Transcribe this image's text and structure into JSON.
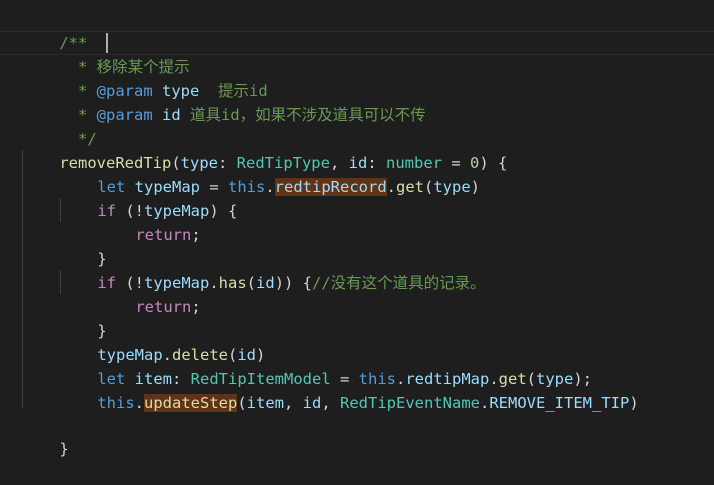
{
  "lines": {
    "l1": "/**",
    "l2": "  * 移除某个提示",
    "l3_prefix": "  * ",
    "l3_tag": "@param",
    "l3_space": " ",
    "l3_name": "type",
    "l3_desc": "  提示id",
    "l4_prefix": "  * ",
    "l4_tag": "@param",
    "l4_space": " ",
    "l4_name": "id",
    "l4_desc": " 道具id，如果不涉及道具可以不传",
    "l5": "  */",
    "l6_fn": "removeRedTip",
    "l6_p1": "(",
    "l6_type_param": "type",
    "l6_colon1": ": ",
    "l6_type1": "RedTipType",
    "l6_comma": ", ",
    "l6_id_param": "id",
    "l6_colon2": ": ",
    "l6_type2": "number",
    "l6_eq": " = ",
    "l6_num": "0",
    "l6_end": ") {",
    "l7_let": "let",
    "l7_sp": " ",
    "l7_var": "typeMap",
    "l7_eq": " = ",
    "l7_this": "this",
    "l7_dot": ".",
    "l7_prop": "redtipRecord",
    "l7_dot2": ".",
    "l7_get": "get",
    "l7_open": "(",
    "l7_arg": "type",
    "l7_close": ")",
    "l8_if": "if",
    "l8_open": " (!",
    "l8_var": "typeMap",
    "l8_end": ") {",
    "l9_return": "return",
    "l9_semi": ";",
    "l10": "}",
    "l11_if": "if",
    "l11_open": " (!",
    "l11_var": "typeMap",
    "l11_dot": ".",
    "l11_has": "has",
    "l11_p": "(",
    "l11_arg": "id",
    "l11_end": ")) {",
    "l11_comment": "//没有这个道具的记录。",
    "l12_return": "return",
    "l12_semi": ";",
    "l13": "}",
    "l14_var": "typeMap",
    "l14_dot": ".",
    "l14_fn": "delete",
    "l14_p": "(",
    "l14_arg": "id",
    "l14_end": ")",
    "l15_let": "let",
    "l15_sp": " ",
    "l15_var": "item",
    "l15_colon": ": ",
    "l15_type": "RedTipItemModel",
    "l15_eq": " = ",
    "l15_this": "this",
    "l15_dot": ".",
    "l15_prop": "redtipMap",
    "l15_dot2": ".",
    "l15_get": "get",
    "l15_p": "(",
    "l15_arg": "type",
    "l15_end": ");",
    "l16_this": "this",
    "l16_dot": ".",
    "l16_fn": "updateStep",
    "l16_p": "(",
    "l16_a1": "item",
    "l16_c1": ", ",
    "l16_a2": "id",
    "l16_c2": ", ",
    "l16_enum": "RedTipEventName",
    "l16_dot2": ".",
    "l16_member": "REMOVE_ITEM_TIP",
    "l16_end": ")",
    "l18": "}"
  },
  "colors": {
    "background": "#1e1e1e",
    "comment": "#6a9955",
    "keyword": "#569cd6",
    "control": "#c586c0",
    "function": "#dcdcaa",
    "type": "#4ec9b0",
    "variable": "#9cdcfe",
    "number": "#b5cea8",
    "highlight": "#613214"
  }
}
